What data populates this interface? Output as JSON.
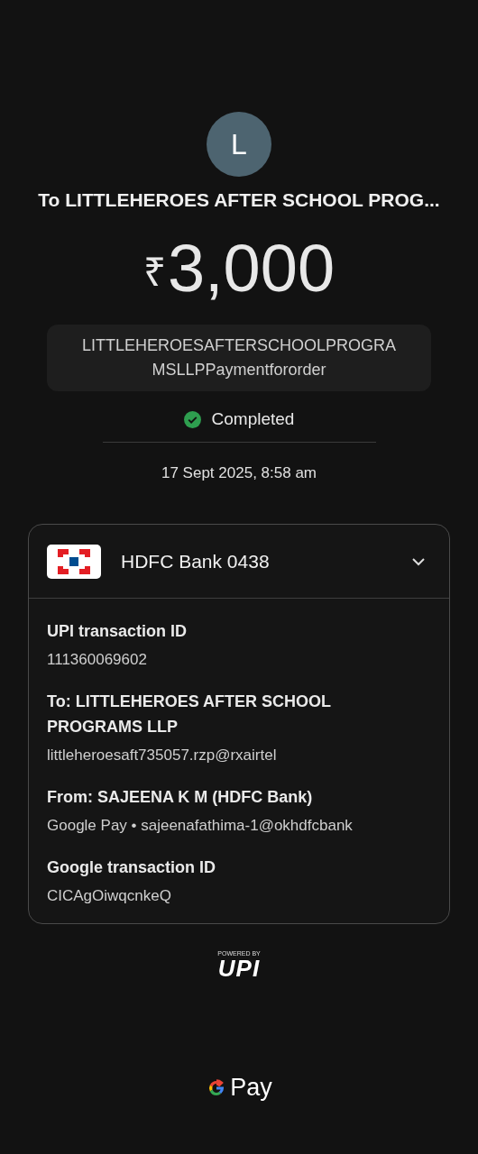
{
  "payee": {
    "initial": "L",
    "title": "To LITTLEHEROES AFTER SCHOOL PROG..."
  },
  "amount": {
    "currency": "₹",
    "value": "3,000"
  },
  "note": "LITTLEHEROESAFTERSCHOOLPROGRA MSLLPPaymentfororder",
  "status": {
    "label": "Completed",
    "kind": "success"
  },
  "datetime": "17 Sept 2025, 8:58 am",
  "account_card": {
    "bank": "HDFC Bank 0438",
    "expanded": true,
    "details": [
      {
        "label": "UPI transaction ID",
        "lines": [
          "111360069602"
        ]
      },
      {
        "label": "To: LITTLEHEROES AFTER SCHOOL PROGRAMS LLP",
        "lines": [
          "littleheroesaft735057.rzp@rxairtel"
        ]
      },
      {
        "label": "From: SAJEENA K M (HDFC Bank)",
        "lines": [
          "Google Pay • sajeenafathima-1@okhdfcbank"
        ]
      },
      {
        "label": "Google transaction ID",
        "lines": [
          "CICAgOiwqcnkeQ"
        ]
      }
    ]
  },
  "footer": {
    "powered_by": "POWERED BY",
    "upi": "UPI",
    "brand": "Pay"
  }
}
